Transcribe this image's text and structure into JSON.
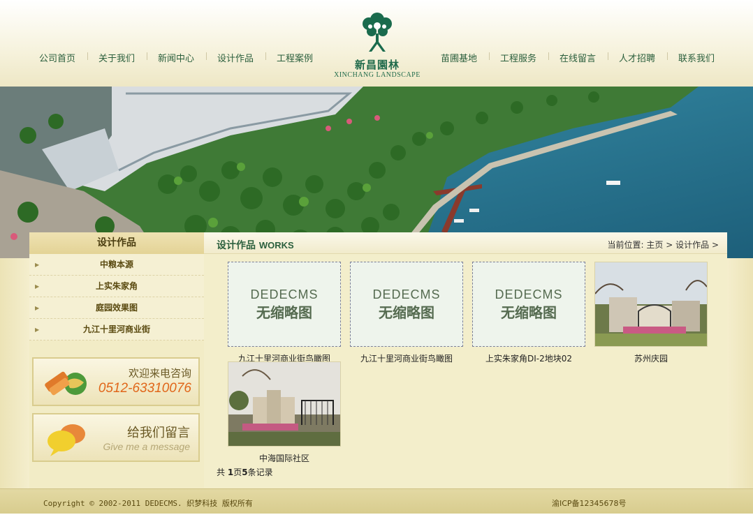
{
  "nav": {
    "left": [
      "公司首页",
      "关于我们",
      "新闻中心",
      "设计作品",
      "工程案例"
    ],
    "right": [
      "苗圃基地",
      "工程服务",
      "在线留言",
      "人才招聘",
      "联系我们"
    ]
  },
  "logo": {
    "name_cn": "新昌園林",
    "name_en": "XINCHANG LANDSCAPE",
    "icon": "tree-logo-icon"
  },
  "sidebar": {
    "title": "设计作品",
    "items": [
      "中粮本源",
      "上实朱家角",
      "庭园效果图",
      "九江十里河商业街"
    ],
    "consult": {
      "title": "欢迎来电咨询",
      "phone": "0512-63310076"
    },
    "message": {
      "title": "给我们留言",
      "subtitle": "Give me a message"
    }
  },
  "content": {
    "title_cn": "设计作品",
    "title_en": "WORKS",
    "breadcrumb": {
      "prefix": "当前位置:",
      "home": "主页",
      "current": "设计作品"
    },
    "placeholder": {
      "line1": "DEDECMS",
      "line2": "无缩略图"
    },
    "works": [
      {
        "caption": "九江十里河商业街鸟瞰图",
        "thumb": "placeholder"
      },
      {
        "caption": "九江十里河商业街鸟瞰图",
        "thumb": "placeholder"
      },
      {
        "caption": "上实朱家角DI-2地块02",
        "thumb": "placeholder"
      },
      {
        "caption": "苏州庆园",
        "thumb": "photo"
      },
      {
        "caption": "中海国际社区",
        "thumb": "photo"
      }
    ],
    "pager": {
      "prefix": "共",
      "pages": "1",
      "page_word": "页",
      "records": "5",
      "record_word": "条记录"
    }
  },
  "footer": {
    "copyright": "Copyright © 2002-2011 DEDECMS. 织梦科技 版权所有",
    "icp": "渝ICP备12345678号"
  },
  "colors": {
    "nav_text": "#2b5f3d",
    "accent_green": "#1f6a4a",
    "phone_orange": "#e0661a",
    "bg_cream": "#f2ecc6"
  }
}
